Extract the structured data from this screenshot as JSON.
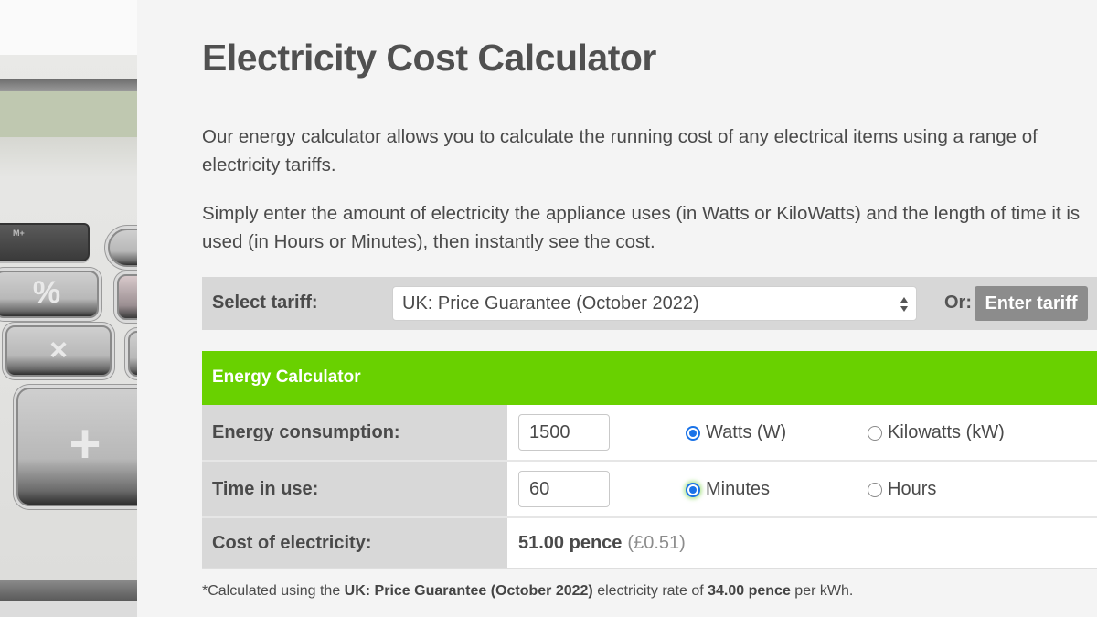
{
  "page": {
    "title": "Electricity Cost Calculator",
    "intro_paragraphs": [
      "Our energy calculator allows you to calculate the running cost of any electrical items using a range of electricity tariffs.",
      "Simply enter the amount of electricity the appliance uses (in Watts or KiloWatts) and the length of time it is used (in Hours or Minutes), then instantly see the cost."
    ]
  },
  "photo": {
    "description": "calculator-keypad-photo",
    "keys": [
      "M+",
      "%",
      "×",
      "+"
    ]
  },
  "tariff": {
    "label": "Select tariff:",
    "selected": "UK: Price Guarantee (October 2022)",
    "or_label": "Or:",
    "enter_button": "Enter tariff"
  },
  "calculator": {
    "header": "Energy Calculator",
    "accent_color": "#69d100",
    "rows": [
      {
        "label": "Energy consumption:",
        "input_value": "1500",
        "options": [
          {
            "label": "Watts (W)",
            "selected": true
          },
          {
            "label": "Kilowatts (kW)",
            "selected": false
          }
        ]
      },
      {
        "label": "Time in use:",
        "input_value": "60",
        "options": [
          {
            "label": "Minutes",
            "selected": true
          },
          {
            "label": "Hours",
            "selected": false
          }
        ]
      }
    ],
    "cost": {
      "label": "Cost of electricity:",
      "pence": "51.00 pence",
      "pounds": "(£0.51)"
    }
  },
  "footnote": {
    "prefix": "*Calculated using the ",
    "tariff": "UK: Price Guarantee (October 2022)",
    "middle": " electricity rate of ",
    "rate": "34.00 pence",
    "suffix": " per kWh."
  }
}
